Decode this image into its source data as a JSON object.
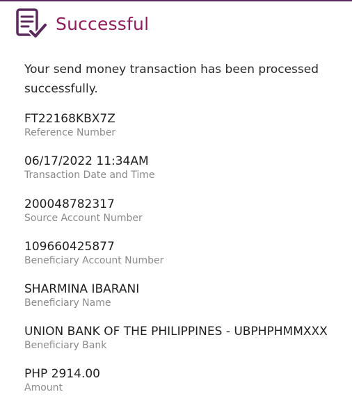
{
  "header": {
    "title": "Successful",
    "icon": "document-check-icon",
    "accent_color": "#8e1d5a",
    "icon_color": "#5b2a5c"
  },
  "message": "Your send money transaction has been processed successfully.",
  "fields": [
    {
      "value": "FT22168KBX7Z",
      "label": "Reference Number"
    },
    {
      "value": "06/17/2022 11:34AM",
      "label": "Transaction Date and Time"
    },
    {
      "value": "200048782317",
      "label": "Source Account Number"
    },
    {
      "value": "109660425877",
      "label": "Beneficiary Account Number"
    },
    {
      "value": "SHARMINA IBARANI",
      "label": "Beneficiary Name"
    },
    {
      "value": "UNION BANK OF THE PHILIPPINES - UBPHPHMMXXX",
      "label": "Beneficiary Bank"
    },
    {
      "value": "PHP 2914.00",
      "label": "Amount"
    }
  ]
}
